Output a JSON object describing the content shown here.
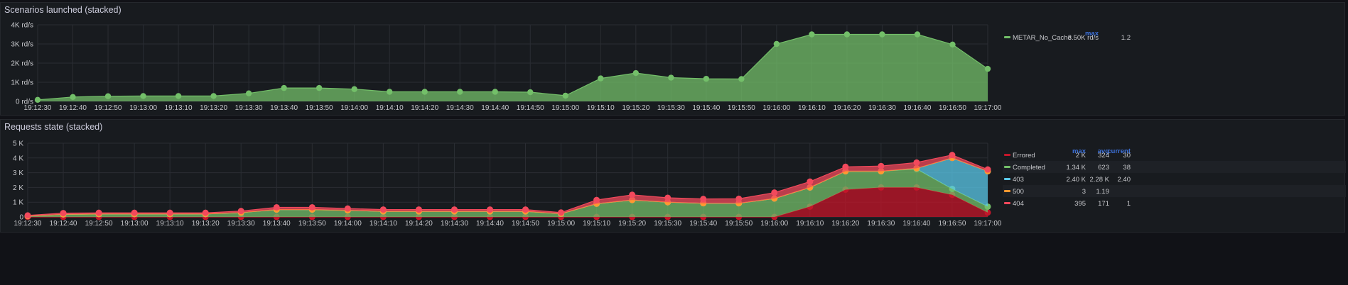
{
  "panels": [
    {
      "title": "Scenarios launched (stacked)",
      "legend": {
        "headers": [
          "max",
          ""
        ],
        "items": [
          {
            "name": "METAR_No_Cache",
            "color": "#73bf69",
            "values": [
              "3.50K rd/s",
              "1.2"
            ]
          }
        ]
      }
    },
    {
      "title": "Requests state (stacked)",
      "legend": {
        "headers": [
          "max",
          "avg",
          "current"
        ],
        "items": [
          {
            "name": "Errored",
            "color": "#c4162a",
            "values": [
              "2 K",
              "324",
              "30"
            ]
          },
          {
            "name": "Completed",
            "color": "#73bf69",
            "values": [
              "1.34 K",
              "623",
              "38"
            ]
          },
          {
            "name": "403",
            "color": "#5ac8e8",
            "values": [
              "2.40 K",
              "2.28 K",
              "2.40"
            ]
          },
          {
            "name": "500",
            "color": "#ff9830",
            "values": [
              "3",
              "1.19",
              ""
            ]
          },
          {
            "name": "404",
            "color": "#f2495c",
            "values": [
              "395",
              "171",
              "1"
            ]
          }
        ]
      }
    }
  ],
  "chart_data": [
    {
      "type": "area",
      "title": "Scenarios launched (stacked)",
      "x": [
        "19:12:30",
        "19:12:40",
        "19:12:50",
        "19:13:00",
        "19:13:10",
        "19:13:20",
        "19:13:30",
        "19:13:40",
        "19:13:50",
        "19:14:00",
        "19:14:10",
        "19:14:20",
        "19:14:30",
        "19:14:40",
        "19:14:50",
        "19:15:00",
        "19:15:10",
        "19:15:20",
        "19:15:30",
        "19:15:40",
        "19:15:50",
        "19:16:00",
        "19:16:10",
        "19:16:20",
        "19:16:30",
        "19:16:40",
        "19:16:50",
        "19:17:00"
      ],
      "yticks": [
        "0 rd/s",
        "1K rd/s",
        "2K rd/s",
        "3K rd/s",
        "4K rd/s"
      ],
      "ylim": [
        0,
        4000
      ],
      "grid": true,
      "legend_position": "right",
      "series": [
        {
          "name": "METAR_No_Cache",
          "color": "#73bf69",
          "values": [
            80,
            230,
            270,
            280,
            280,
            280,
            420,
            700,
            700,
            640,
            500,
            500,
            500,
            500,
            480,
            300,
            1200,
            1480,
            1240,
            1180,
            1170,
            3000,
            3500,
            3500,
            3500,
            3500,
            2970,
            1700
          ]
        }
      ]
    },
    {
      "type": "area",
      "title": "Requests state (stacked)",
      "stacked": true,
      "x": [
        "19:12:30",
        "19:12:40",
        "19:12:50",
        "19:13:00",
        "19:13:10",
        "19:13:20",
        "19:13:30",
        "19:13:40",
        "19:13:50",
        "19:14:00",
        "19:14:10",
        "19:14:20",
        "19:14:30",
        "19:14:40",
        "19:14:50",
        "19:15:00",
        "19:15:10",
        "19:15:20",
        "19:15:30",
        "19:15:40",
        "19:15:50",
        "19:16:00",
        "19:16:10",
        "19:16:20",
        "19:16:30",
        "19:16:40",
        "19:16:50",
        "19:17:00"
      ],
      "yticks": [
        "0",
        "1 K",
        "2 K",
        "3 K",
        "4 K",
        "5 K"
      ],
      "ylim": [
        0,
        5000
      ],
      "grid": true,
      "legend_position": "right",
      "series": [
        {
          "name": "Errored",
          "color": "#c4162a",
          "values": [
            0,
            0,
            0,
            0,
            0,
            0,
            0,
            0,
            0,
            0,
            0,
            0,
            0,
            0,
            0,
            0,
            0,
            0,
            0,
            0,
            0,
            0,
            700,
            1850,
            2000,
            2000,
            1500,
            300
          ]
        },
        {
          "name": "Completed",
          "color": "#73bf69",
          "values": [
            60,
            180,
            200,
            200,
            200,
            200,
            300,
            500,
            500,
            450,
            380,
            380,
            380,
            380,
            380,
            220,
            900,
            1150,
            1000,
            930,
            930,
            1250,
            1300,
            1250,
            1100,
            1250,
            400,
            400
          ]
        },
        {
          "name": "403",
          "color": "#5ac8e8",
          "values": [
            0,
            0,
            0,
            0,
            0,
            0,
            0,
            0,
            0,
            0,
            0,
            0,
            0,
            0,
            0,
            0,
            0,
            0,
            0,
            0,
            0,
            0,
            0,
            0,
            0,
            50,
            2100,
            2400
          ]
        },
        {
          "name": "500",
          "color": "#ff9830",
          "values": [
            0,
            0,
            0,
            0,
            0,
            0,
            0,
            0,
            0,
            0,
            0,
            0,
            0,
            0,
            0,
            0,
            0,
            0,
            0,
            0,
            0,
            0,
            0,
            0,
            0,
            0,
            0,
            0
          ]
        },
        {
          "name": "404",
          "color": "#f2495c",
          "values": [
            40,
            80,
            80,
            80,
            80,
            80,
            100,
            150,
            150,
            120,
            120,
            120,
            120,
            120,
            120,
            80,
            250,
            350,
            300,
            290,
            300,
            400,
            395,
            300,
            350,
            390,
            200,
            120
          ]
        }
      ]
    }
  ]
}
